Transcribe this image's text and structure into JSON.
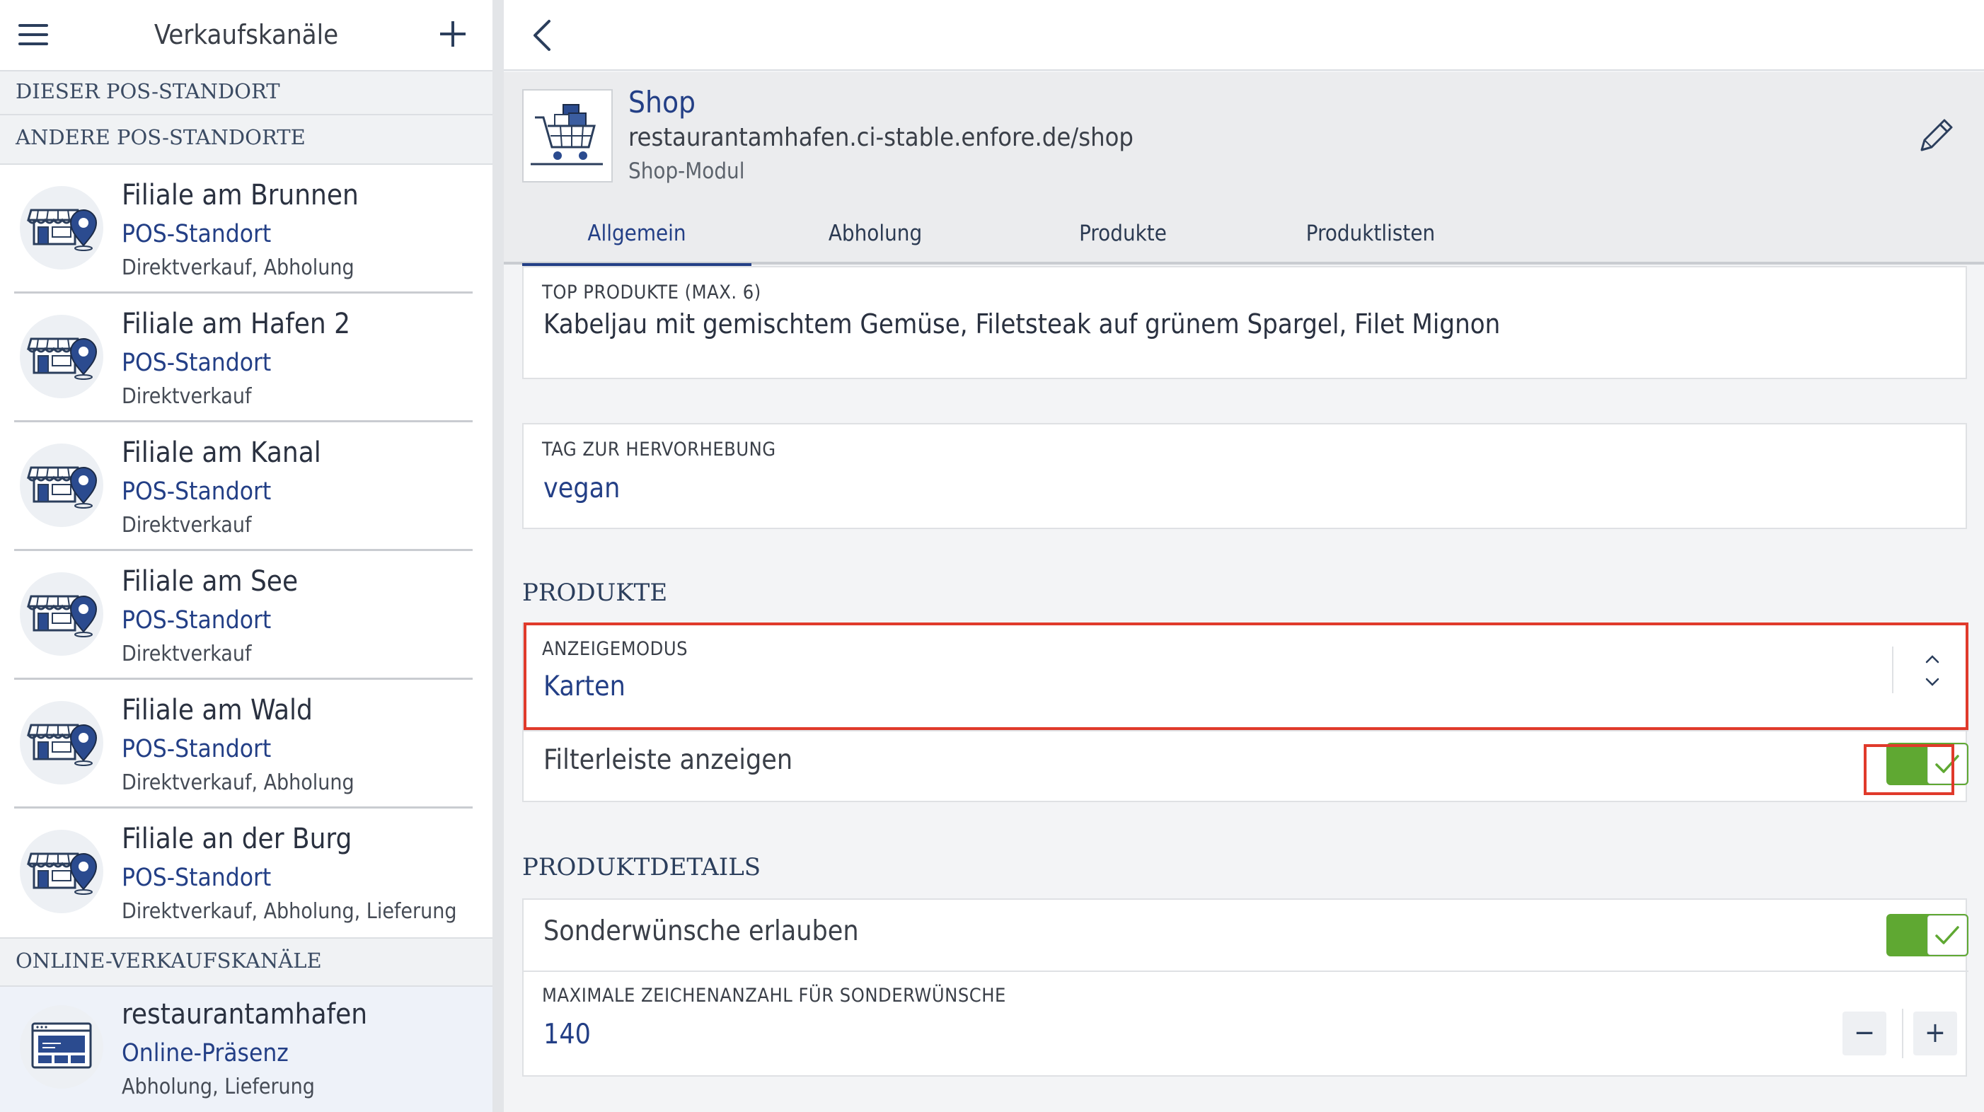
{
  "sidebar": {
    "title": "Verkaufskanäle",
    "section_this": "DIESER POS-STANDORT",
    "section_other": "ANDERE POS-STANDORTE",
    "section_online": "ONLINE-VERKAUFSKANÄLE",
    "items": [
      {
        "title": "Filiale am Brunnen",
        "type": "POS-Standort",
        "sub": "Direktverkauf, Abholung"
      },
      {
        "title": "Filiale am Hafen 2",
        "type": "POS-Standort",
        "sub": "Direktverkauf"
      },
      {
        "title": "Filiale am Kanal",
        "type": "POS-Standort",
        "sub": "Direktverkauf"
      },
      {
        "title": "Filiale am See",
        "type": "POS-Standort",
        "sub": "Direktverkauf"
      },
      {
        "title": "Filiale am Wald",
        "type": "POS-Standort",
        "sub": "Direktverkauf, Abholung"
      },
      {
        "title": "Filiale an der Burg",
        "type": "POS-Standort",
        "sub": "Direktverkauf, Abholung, Lieferung"
      }
    ],
    "online_items": [
      {
        "title": "restaurantamhafen",
        "type": "Online-Präsenz",
        "sub": "Abholung, Lieferung"
      }
    ]
  },
  "shop": {
    "name": "Shop",
    "url": "restaurantamhafen.ci-stable.enfore.de/shop",
    "module": "Shop-Modul"
  },
  "tabs": [
    {
      "label": "Allgemein",
      "active": true
    },
    {
      "label": "Abholung",
      "active": false
    },
    {
      "label": "Produkte",
      "active": false
    },
    {
      "label": "Produktlisten",
      "active": false
    }
  ],
  "top_products": {
    "label": "TOP PRODUKTE (MAX. 6)",
    "value": "Kabeljau mit gemischtem Gemüse, Filetsteak auf grünem Spargel, Filet Mignon"
  },
  "highlight_tag": {
    "label": "TAG ZUR HERVORHEBUNG",
    "value": "vegan"
  },
  "produkte": {
    "title": "PRODUKTE",
    "display_mode_label": "ANZEIGEMODUS",
    "display_mode_value": "Karten",
    "filter_bar_label": "Filterleiste anzeigen",
    "filter_bar_on": true
  },
  "produktdetails": {
    "title": "PRODUKTDETAILS",
    "special_requests_label": "Sonderwünsche erlauben",
    "special_requests_on": true,
    "max_chars_label": "MAXIMALE ZEICHENANZAHL FÜR SONDERWÜNSCHE",
    "max_chars_value": "140"
  },
  "colors": {
    "accent": "#233f86",
    "toggle_on": "#5fa832",
    "highlight": "#e03a2b"
  },
  "icons": {
    "menu": "hamburger-menu-icon",
    "add": "plus-icon",
    "back": "chevron-left-icon",
    "edit": "pencil-icon",
    "store": "store-location-icon",
    "web": "browser-window-icon",
    "shop_image": "shopping-cart-icon",
    "select": "up-down-chevron-icon",
    "check": "checkmark-icon"
  }
}
